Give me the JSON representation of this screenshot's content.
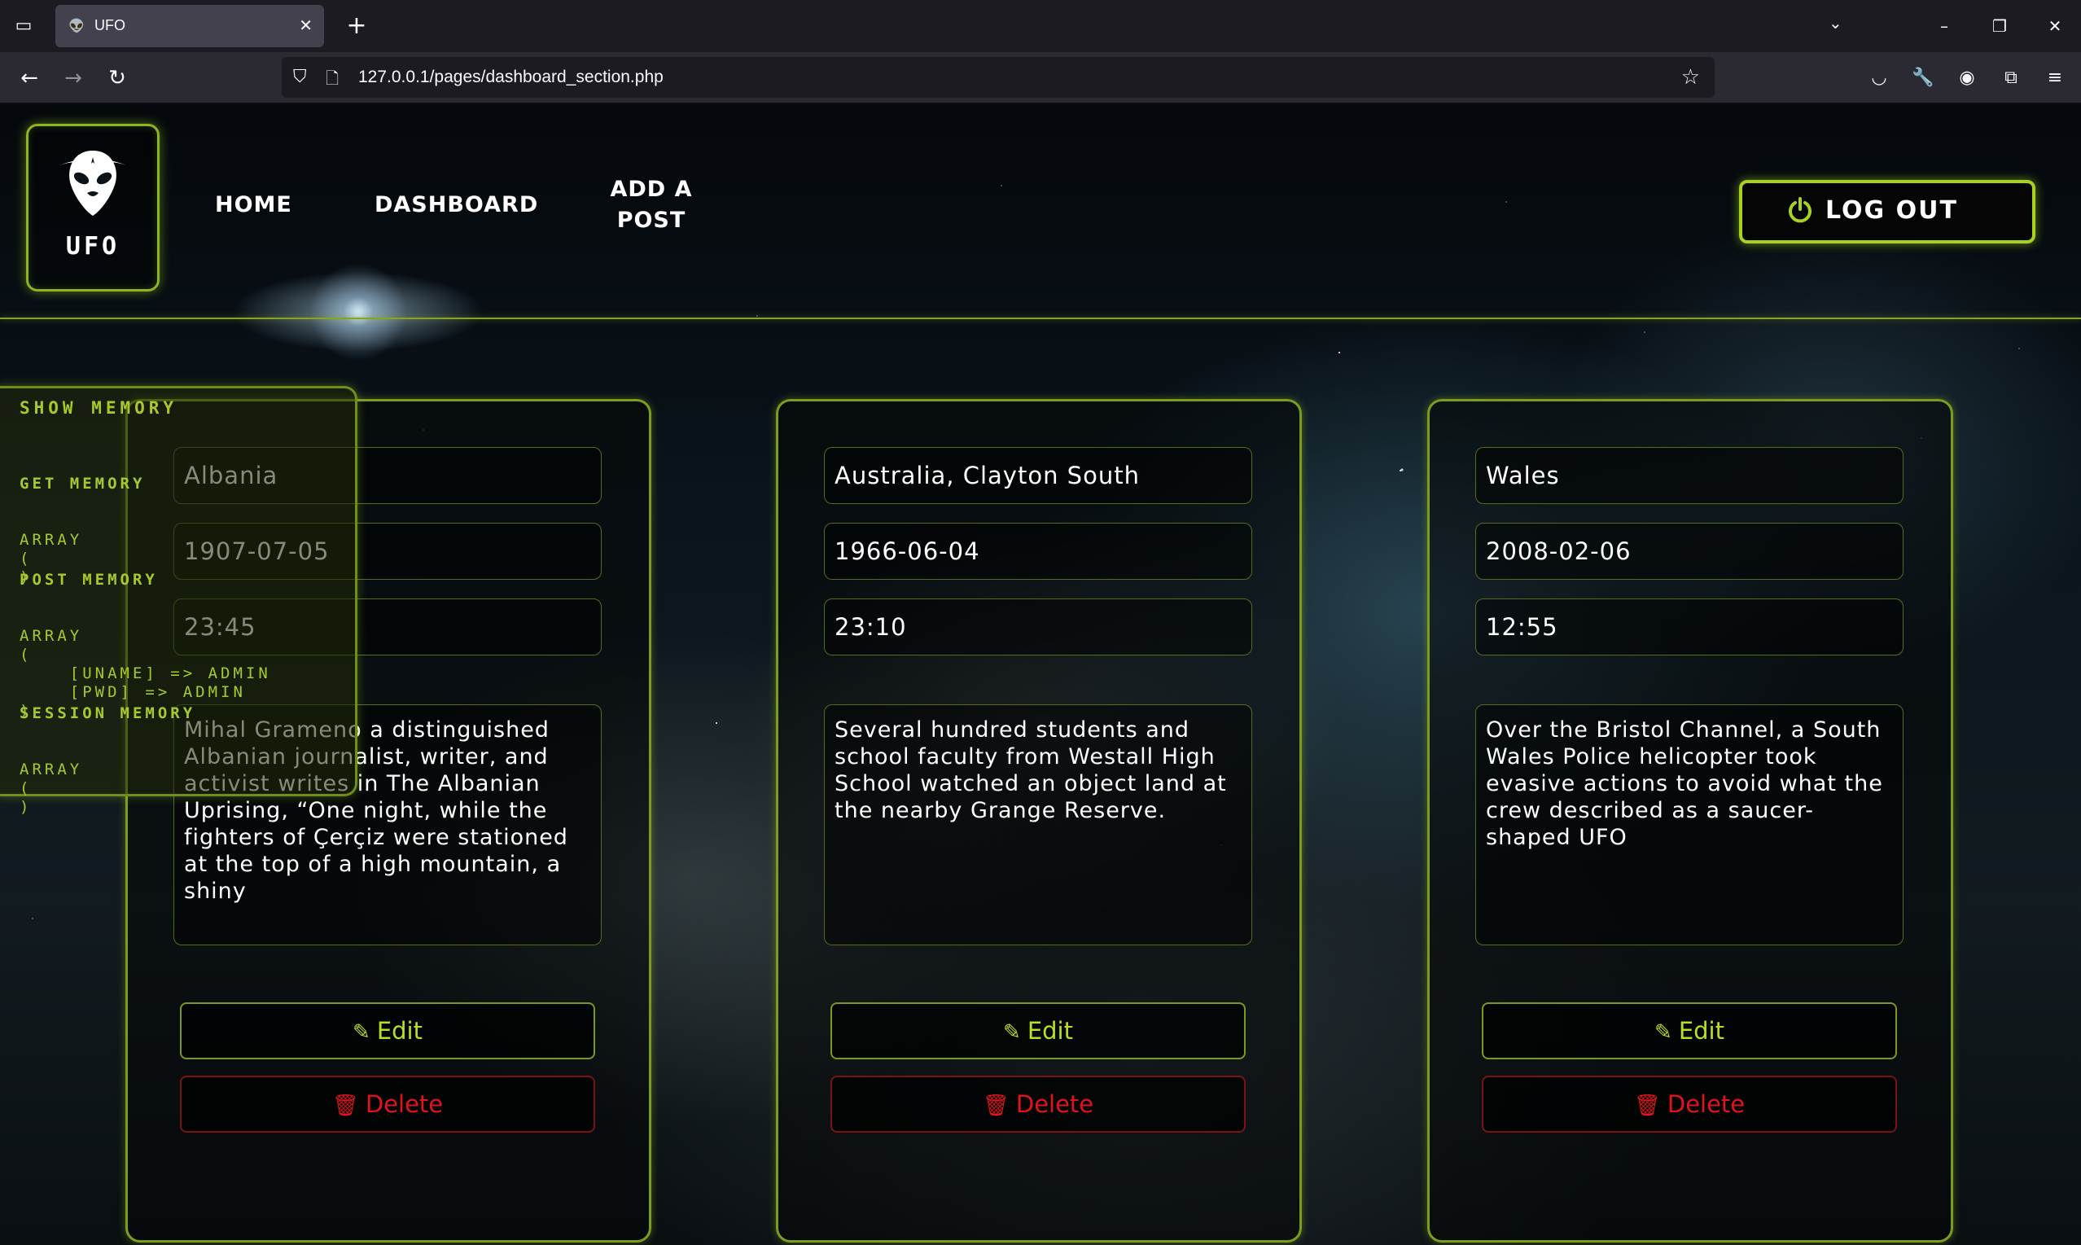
{
  "browser": {
    "tab_title": "UFO",
    "url": "127.0.0.1/pages/dashboard_section.php"
  },
  "header": {
    "logo_text": "UFO",
    "nav": [
      {
        "label": "HOME"
      },
      {
        "label": "DASHBOARD"
      },
      {
        "label": "ADD A POST"
      }
    ],
    "logout_label": "LOG OUT"
  },
  "memory": {
    "title": "SHOW MEMORY",
    "get_label": "GET MEMORY",
    "get_value": "ARRAY\n(\n)",
    "post_label": "POST MEMORY",
    "post_value": "ARRAY\n(\n    [UNAME] => ADMIN\n    [PWD] => ADMIN\n)",
    "session_label": "SESSION MEMORY",
    "session_value": "ARRAY\n(\n)"
  },
  "posts": [
    {
      "country": "Albania",
      "date": "1907-07-05",
      "time": "23:45",
      "description": "Mihal Grameno a distinguished Albanian journalist, writer, and activist writes in The Albanian Uprising, “One night, while the fighters of Çerçiz were stationed at the top of a high mountain, a shiny",
      "edit_label": "Edit",
      "delete_label": "Delete"
    },
    {
      "country": "Australia, Clayton South",
      "date": "1966-06-04",
      "time": "23:10",
      "description": "Several hundred students and school faculty from Westall High School watched an object land at the nearby Grange Reserve.",
      "edit_label": "Edit",
      "delete_label": "Delete"
    },
    {
      "country": "Wales",
      "date": "2008-02-06",
      "time": "12:55",
      "description": "Over the Bristol Channel, a South Wales Police helicopter took evasive actions to avoid what the crew described as a saucer-shaped UFO",
      "edit_label": "Edit",
      "delete_label": "Delete"
    }
  ],
  "icons": {
    "edit": "pencil-icon",
    "delete": "trash-icon",
    "logout": "power-icon",
    "logo": "alien-icon"
  },
  "colors": {
    "accent": "#a8d21e",
    "danger": "#e0141a"
  }
}
